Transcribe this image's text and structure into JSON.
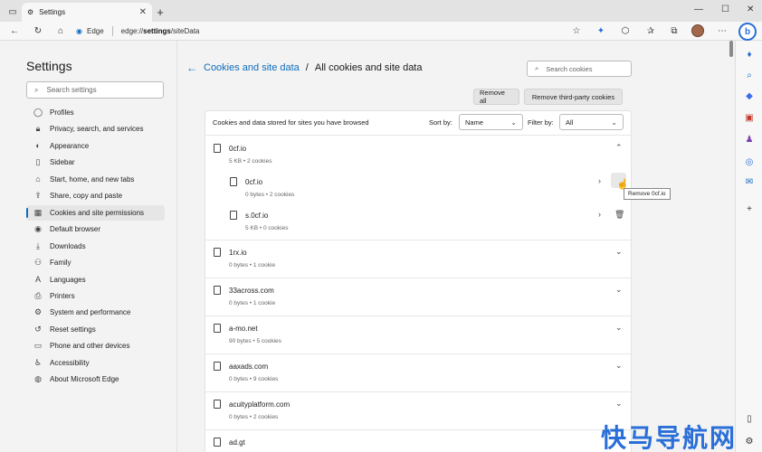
{
  "browser": {
    "tab_title": "Settings",
    "tab_close": "✕",
    "new_tab": "+",
    "address_site": "Edge",
    "address_prefix": "edge://",
    "address_bold": "settings",
    "address_suffix": "/siteData",
    "window_controls": [
      "—",
      "☐",
      "✕"
    ],
    "bing_label": "b"
  },
  "sidebar": {
    "title": "Settings",
    "search_placeholder": "Search settings",
    "items": [
      {
        "label": "Profiles",
        "icon": "profile-icon"
      },
      {
        "label": "Privacy, search, and services",
        "icon": "lock-icon"
      },
      {
        "label": "Appearance",
        "icon": "palette-icon"
      },
      {
        "label": "Sidebar",
        "icon": "sidebar-icon"
      },
      {
        "label": "Start, home, and new tabs",
        "icon": "home-icon"
      },
      {
        "label": "Share, copy and paste",
        "icon": "share-icon"
      },
      {
        "label": "Cookies and site permissions",
        "icon": "cookie-icon",
        "active": true
      },
      {
        "label": "Default browser",
        "icon": "browser-icon"
      },
      {
        "label": "Downloads",
        "icon": "download-icon"
      },
      {
        "label": "Family",
        "icon": "family-icon"
      },
      {
        "label": "Languages",
        "icon": "language-icon"
      },
      {
        "label": "Printers",
        "icon": "printer-icon"
      },
      {
        "label": "System and performance",
        "icon": "system-icon"
      },
      {
        "label": "Reset settings",
        "icon": "reset-icon"
      },
      {
        "label": "Phone and other devices",
        "icon": "phone-icon"
      },
      {
        "label": "Accessibility",
        "icon": "accessibility-icon"
      },
      {
        "label": "About Microsoft Edge",
        "icon": "edge-icon"
      }
    ]
  },
  "page": {
    "breadcrumb_link": "Cookies and site data",
    "breadcrumb_sep": "/",
    "breadcrumb_current": "All cookies and site data",
    "search_placeholder": "Search cookies",
    "remove_all": "Remove all",
    "remove_third_party": "Remove third-party cookies",
    "panel_heading": "Cookies and data stored for sites you have browsed",
    "sort_label": "Sort by:",
    "sort_value": "Name",
    "filter_label": "Filter by:",
    "filter_value": "All",
    "tooltip": "Remove 0cf.io"
  },
  "sites": [
    {
      "name": "0cf.io",
      "meta": "5 KB • 2 cookies",
      "expanded": true,
      "children": [
        {
          "name": "0cf.io",
          "meta": "0 bytes • 2 cookies"
        },
        {
          "name": "s.0cf.io",
          "meta": "5 KB • 0 cookies"
        }
      ]
    },
    {
      "name": "1rx.io",
      "meta": "0 bytes • 1 cookie"
    },
    {
      "name": "33across.com",
      "meta": "0 bytes • 1 cookie"
    },
    {
      "name": "a-mo.net",
      "meta": "90 bytes • 5 cookies"
    },
    {
      "name": "aaxads.com",
      "meta": "0 bytes • 9 cookies"
    },
    {
      "name": "acuityplatform.com",
      "meta": "0 bytes • 2 cookies"
    },
    {
      "name": "ad.gt",
      "meta": ""
    }
  ],
  "watermark": "快马导航网"
}
